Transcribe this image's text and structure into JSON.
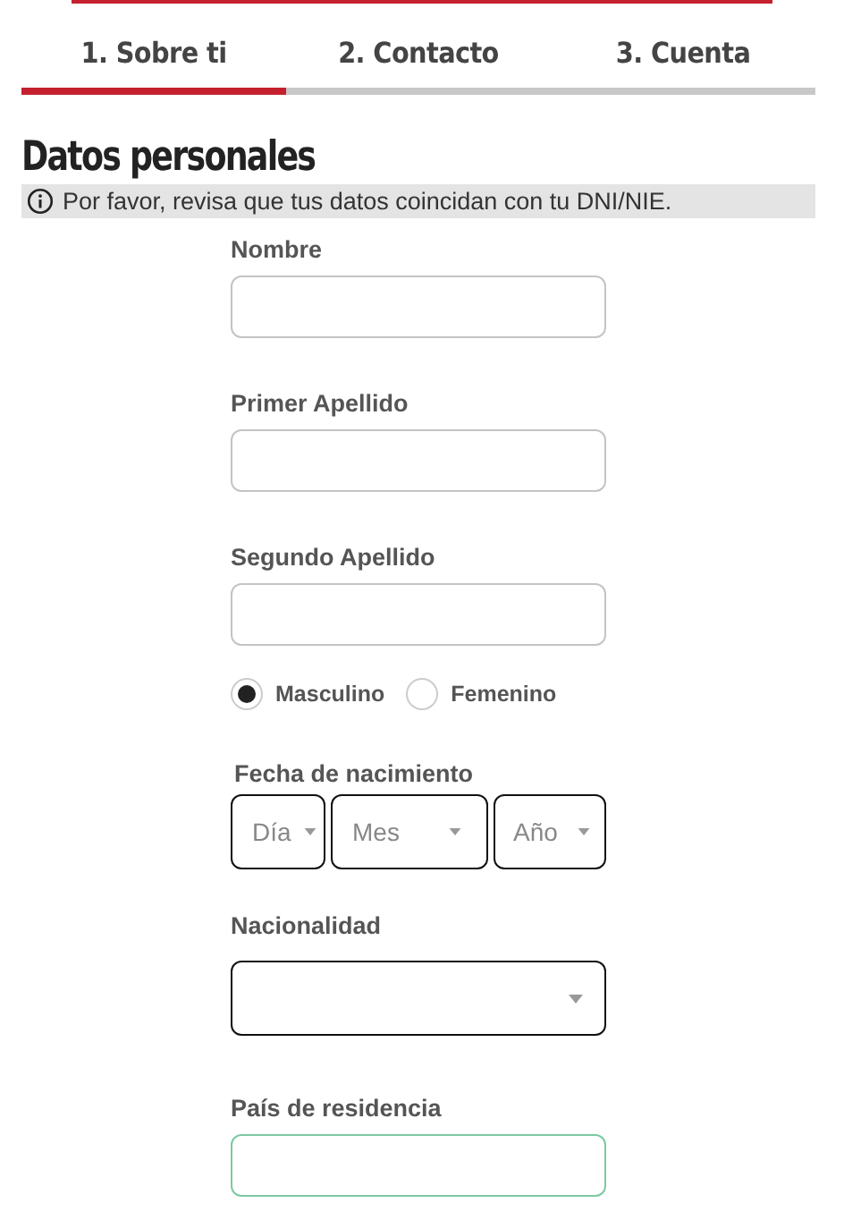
{
  "tabs": [
    {
      "label": "1. Sobre ti",
      "selected": true
    },
    {
      "label": "2. Contacto",
      "selected": false
    },
    {
      "label": "3. Cuenta",
      "selected": false
    }
  ],
  "heading": "Datos personales",
  "notice": "Por favor, revisa que tus datos coincidan con tu DNI/NIE.",
  "fields": [
    {
      "kind": "text",
      "label": "Nombre",
      "focused": false
    },
    {
      "kind": "text",
      "label": "Primer Apellido",
      "focused": false
    },
    {
      "kind": "text",
      "label": "Segundo Apellido",
      "focused": false
    },
    {
      "kind": "radio",
      "options": [
        {
          "label": "Masculino",
          "selected": true
        },
        {
          "label": "Femenino",
          "selected": false
        }
      ]
    },
    {
      "kind": "date",
      "label": "Fecha de nacimiento",
      "parts": [
        {
          "placeholder": "Día"
        },
        {
          "placeholder": "Mes"
        },
        {
          "placeholder": "Año"
        }
      ]
    },
    {
      "kind": "select",
      "label": "Nacionalidad",
      "focused": false
    },
    {
      "kind": "text",
      "label": "País de residencia",
      "focused": true
    }
  ]
}
